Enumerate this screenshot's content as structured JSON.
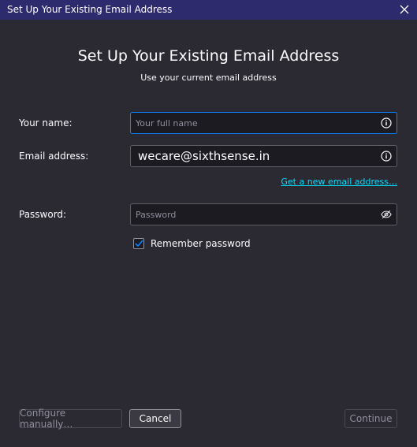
{
  "window": {
    "title": "Set Up Your Existing Email Address",
    "close_icon": "close-icon"
  },
  "header": {
    "title": "Set Up Your Existing Email Address",
    "subtitle": "Use your current email address"
  },
  "form": {
    "name_label": "Your name:",
    "name_placeholder": "Your full name",
    "name_value": "",
    "email_label": "Email address:",
    "email_value": "wecare@sixthsense.in",
    "new_email_link": "Get a new email address…",
    "password_label": "Password:",
    "password_placeholder": "Password",
    "password_value": "",
    "remember_label": "Remember password",
    "remember_checked": true
  },
  "buttons": {
    "configure_label": "Configure manually…",
    "cancel_label": "Cancel",
    "continue_label": "Continue"
  },
  "colors": {
    "accent": "#0a84ff",
    "link": "#00ddff",
    "titlebar": "#2e2a6e",
    "background": "#2b2a33"
  }
}
